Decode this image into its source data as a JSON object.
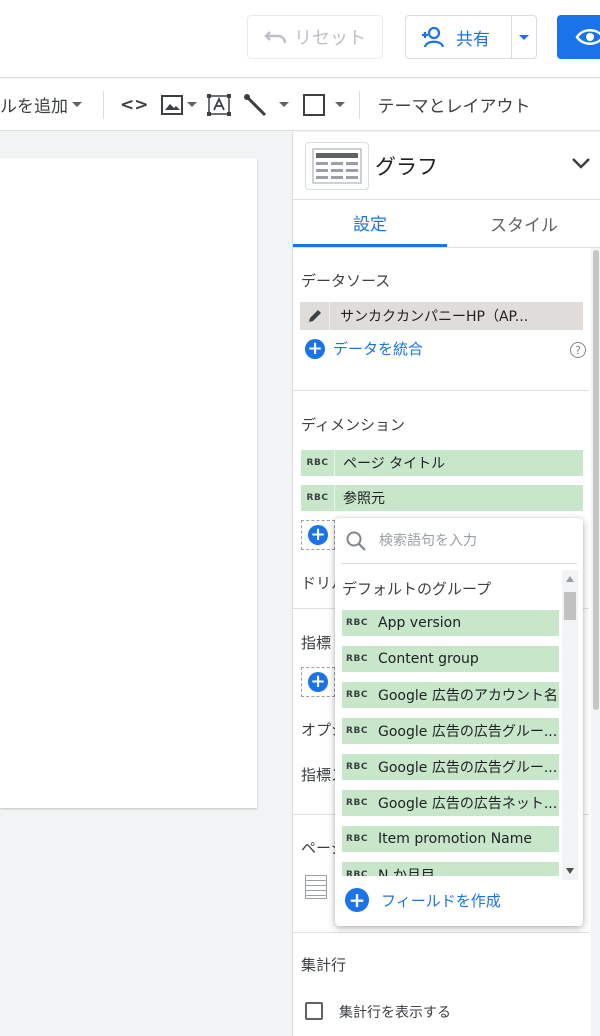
{
  "header": {
    "reset_label": "リセット",
    "share_label": "共有"
  },
  "toolbar": {
    "add_control_label": "ルを追加",
    "code_label": "<>",
    "theme_label": "テーマとレイアウト"
  },
  "panel": {
    "chart_type": "グラフ",
    "tabs": [
      {
        "label": "設定"
      },
      {
        "label": "スタイル"
      }
    ],
    "datasource_label": "データソース",
    "datasource_name": "サンカクカンパニーHP（AP...",
    "blend_label": "データを統合",
    "dimension_label": "ディメンション",
    "dimensions": [
      {
        "label": "ページ タイトル"
      },
      {
        "label": "参照元"
      }
    ],
    "drill_label": "ドリル",
    "metric_label": "指標",
    "option_label": "オプシ",
    "metric_slider_label": "指標ス",
    "page_label": "ページ",
    "summary_label": "集計行",
    "summary_checkbox_label": "集計行を表示する"
  },
  "popup": {
    "search_placeholder": "検索語句を入力",
    "group_title": "デフォルトのグループ",
    "fields": [
      {
        "label": "App version"
      },
      {
        "label": "Content group"
      },
      {
        "label": "Google 広告のアカウント名"
      },
      {
        "label": "Google 広告の広告グルー..."
      },
      {
        "label": "Google 広告の広告グルー..."
      },
      {
        "label": "Google 広告の広告ネット..."
      },
      {
        "label": "Item promotion Name"
      },
      {
        "label": "N か月目"
      }
    ],
    "create_field_label": "フィールドを作成"
  },
  "colors": {
    "accent": "#1a73e8",
    "dimension_chip": "#c8e6c9",
    "datasource_chip": "#e0dcd9"
  }
}
